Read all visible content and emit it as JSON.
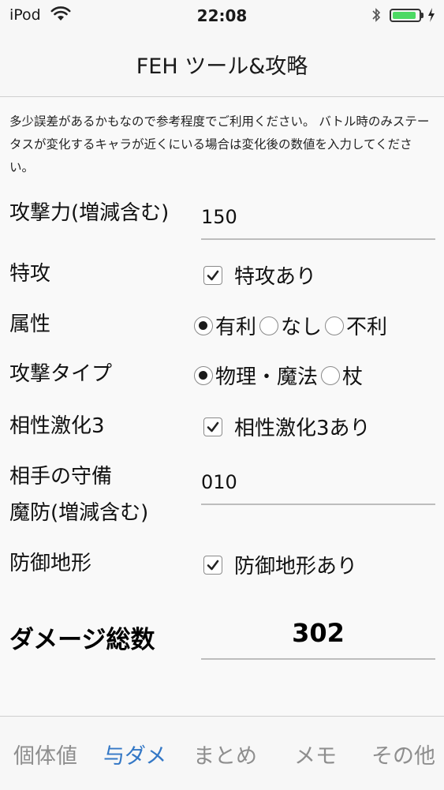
{
  "status_bar": {
    "carrier": "iPod",
    "time": "22:08",
    "battery_percent": 90,
    "battery_color": "#4cd964",
    "icons": [
      "wifi-icon",
      "bluetooth-icon",
      "battery-icon",
      "charging-bolt-icon"
    ]
  },
  "nav": {
    "title": "FEH ツール&攻略"
  },
  "notice": "多少誤差があるかもなので参考程度でご利用ください。 バトル時のみステータスが変化するキャラが近くにいる場合は変化後の数値を入力してください。",
  "form": {
    "attack": {
      "label": "攻撃力(増減含む)",
      "value": "150"
    },
    "effective": {
      "label": "特攻",
      "option": "特攻あり",
      "checked": true
    },
    "affinity": {
      "label": "属性",
      "options": [
        {
          "text": "有利",
          "selected": true
        },
        {
          "text": "なし",
          "selected": false
        },
        {
          "text": "不利",
          "selected": false
        }
      ]
    },
    "attack_type": {
      "label": "攻撃タイプ",
      "options": [
        {
          "text": "物理・魔法",
          "selected": true
        },
        {
          "text": "杖",
          "selected": false
        }
      ]
    },
    "triangle": {
      "label": "相性激化3",
      "option": "相性激化3あり",
      "checked": true
    },
    "defense": {
      "label_line1": "相手の守備",
      "label_line2": "魔防(増減含む)",
      "value": "010"
    },
    "terrain": {
      "label": "防御地形",
      "option": "防御地形あり",
      "checked": true
    }
  },
  "total": {
    "label": "ダメージ総数",
    "value": "302"
  },
  "tabs": [
    {
      "label": "個体値",
      "active": false
    },
    {
      "label": "与ダメ",
      "active": true
    },
    {
      "label": "まとめ",
      "active": false
    },
    {
      "label": "メモ",
      "active": false
    },
    {
      "label": "その他",
      "active": false
    }
  ],
  "colors": {
    "tab_active": "#3478c6",
    "tab_inactive": "#8e8e8e"
  }
}
